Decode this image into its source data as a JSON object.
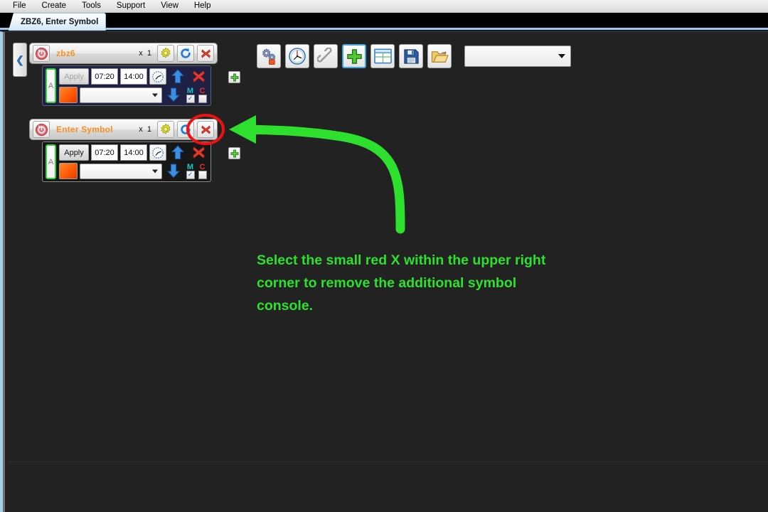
{
  "menubar": {
    "items": [
      {
        "label": "File"
      },
      {
        "label": "Create"
      },
      {
        "label": "Tools"
      },
      {
        "label": "Support"
      },
      {
        "label": "View"
      },
      {
        "label": "Help"
      }
    ]
  },
  "tab": {
    "label": "ZBZ6, Enter Symbol"
  },
  "sidebar": {
    "collapse_glyph": "❮"
  },
  "consoles": [
    {
      "title": "zbz6",
      "multiplier": "x  1",
      "history_icon": "history-clock-icon",
      "gear_icon": "gear-icon",
      "refresh_icon": "refresh-icon",
      "close_icon": "red-x-icon",
      "lane_label": "A",
      "apply_label": "Apply",
      "apply_enabled": false,
      "time_start": "07:20",
      "time_end": "14:00",
      "clock_icon": "clock-schedule-icon",
      "up_icon": "blue-up-arrow-icon",
      "down_icon": "blue-down-arrow-icon",
      "delete_icon": "red-x-icon",
      "color_swatch": "#ff5a05",
      "symbol_select_value": "",
      "checkboxes": [
        {
          "label": "M",
          "checked": true,
          "color": "#17c6c6"
        },
        {
          "label": "C",
          "checked": false,
          "color": "#ef2b2b"
        }
      ],
      "add_icon": "green-plus-icon",
      "body_theme": "navy"
    },
    {
      "title": "Enter Symbol",
      "multiplier": "x  1",
      "history_icon": "history-clock-icon",
      "gear_icon": "gear-icon",
      "refresh_icon": "refresh-icon",
      "close_icon": "red-x-icon",
      "lane_label": "A",
      "apply_label": "Apply",
      "apply_enabled": true,
      "time_start": "07:20",
      "time_end": "14:00",
      "clock_icon": "clock-schedule-icon",
      "up_icon": "blue-up-arrow-icon",
      "down_icon": "blue-down-arrow-icon",
      "delete_icon": "red-x-icon",
      "color_swatch": "#ff5a05",
      "symbol_select_value": "",
      "checkboxes": [
        {
          "label": "M",
          "checked": true,
          "color": "#17c6c6"
        },
        {
          "label": "C",
          "checked": false,
          "color": "#ef2b2b"
        }
      ],
      "add_icon": "green-plus-icon",
      "body_theme": "dark"
    }
  ],
  "toolbar": {
    "buttons": [
      {
        "icon": "gears-settings-icon",
        "selected": false
      },
      {
        "icon": "clock-icon",
        "selected": false
      },
      {
        "icon": "chain-link-icon",
        "selected": false
      },
      {
        "icon": "green-plus-icon",
        "selected": true
      },
      {
        "icon": "grid-window-icon",
        "selected": false
      },
      {
        "icon": "floppy-save-icon",
        "selected": false
      },
      {
        "icon": "open-folder-icon",
        "selected": false
      }
    ],
    "dropdown_value": ""
  },
  "annotation": {
    "text": "Select the small red X within the upper right corner to remove the additional symbol console.",
    "color": "#2ee02e",
    "highlight_color": "#ee1111",
    "arrow_color": "#2ee02e"
  }
}
